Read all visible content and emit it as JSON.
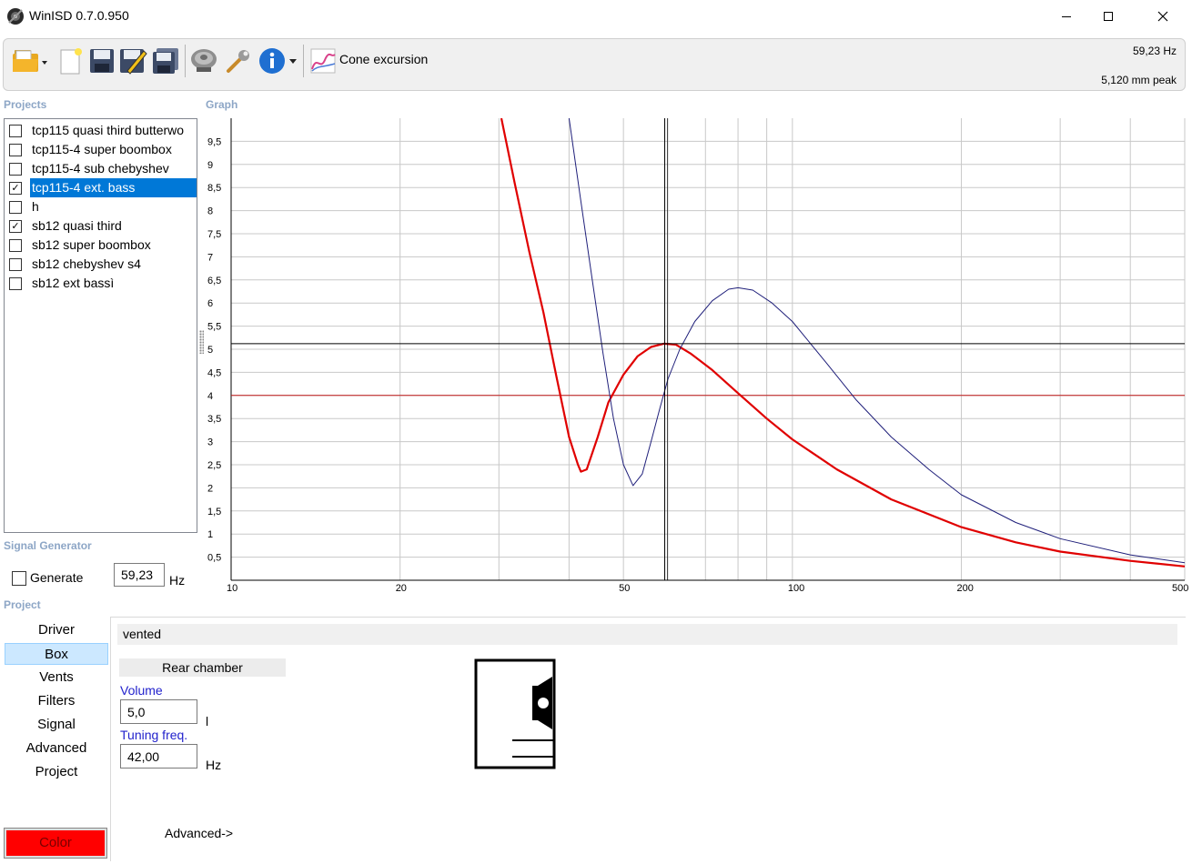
{
  "window": {
    "title": "WinISD 0.7.0.950",
    "controls": {
      "minimize": "—",
      "maximize": "☐",
      "close": "✕"
    }
  },
  "toolbar": {
    "buttons": [
      "open-folder-icon",
      "new-project-icon",
      "save-icon",
      "save-as-icon",
      "save-all-icon",
      "driver-icon",
      "tools-icon",
      "info-icon",
      "graph-icon"
    ],
    "graph_label": "Cone excursion",
    "frequency_readout": "59,23 Hz",
    "peak_readout": "5,120 mm peak"
  },
  "projects": {
    "label": "Projects",
    "items": [
      {
        "name": "tcp115 quasi third butterwo",
        "checked": false,
        "selected": false
      },
      {
        "name": "tcp115-4 super boombox",
        "checked": false,
        "selected": false
      },
      {
        "name": "tcp115-4 sub chebyshev",
        "checked": false,
        "selected": false
      },
      {
        "name": "tcp115-4 ext. bass",
        "checked": true,
        "selected": true
      },
      {
        "name": "h",
        "checked": false,
        "selected": false
      },
      {
        "name": "sb12 quasi third",
        "checked": true,
        "selected": false
      },
      {
        "name": "sb12 super boombox",
        "checked": false,
        "selected": false
      },
      {
        "name": "sb12 chebyshev s4",
        "checked": false,
        "selected": false
      },
      {
        "name": "sb12 ext bassì",
        "checked": false,
        "selected": false
      }
    ]
  },
  "signal_generator": {
    "label": "Signal Generator",
    "generate_label": "Generate",
    "generate_checked": false,
    "frequency": "59,23",
    "unit": "Hz"
  },
  "graph": {
    "label": "Graph"
  },
  "chart_data": {
    "type": "line",
    "x_scale": "log",
    "xlim": [
      10,
      500
    ],
    "ylim": [
      0,
      10
    ],
    "x_ticks": [
      "10",
      "20",
      "50",
      "100",
      "200",
      "500"
    ],
    "y_ticks": [
      "0,5",
      "1",
      "1,5",
      "2",
      "2,5",
      "3",
      "3,5",
      "4",
      "4,5",
      "5",
      "5,5",
      "6",
      "6,5",
      "7",
      "7,5",
      "8",
      "8,5",
      "9",
      "9,5"
    ],
    "grid": true,
    "cursor": {
      "x": 59.23,
      "y": 5.12,
      "y_limit": 4.0
    },
    "series": [
      {
        "color": "#e00000",
        "points": [
          [
            30.3,
            10.0
          ],
          [
            32,
            8.6
          ],
          [
            34,
            7.1
          ],
          [
            36,
            5.8
          ],
          [
            38,
            4.4
          ],
          [
            40,
            3.1
          ],
          [
            41.5,
            2.5
          ],
          [
            42,
            2.35
          ],
          [
            43,
            2.4
          ],
          [
            45,
            3.1
          ],
          [
            47,
            3.85
          ],
          [
            50,
            4.45
          ],
          [
            53,
            4.85
          ],
          [
            56,
            5.05
          ],
          [
            59,
            5.12
          ],
          [
            62,
            5.1
          ],
          [
            66,
            4.9
          ],
          [
            72,
            4.55
          ],
          [
            80,
            4.05
          ],
          [
            90,
            3.5
          ],
          [
            100,
            3.05
          ],
          [
            120,
            2.4
          ],
          [
            150,
            1.75
          ],
          [
            200,
            1.15
          ],
          [
            250,
            0.82
          ],
          [
            300,
            0.62
          ],
          [
            400,
            0.42
          ],
          [
            500,
            0.3
          ]
        ]
      },
      {
        "color": "#1f1f7a",
        "points": [
          [
            40.0,
            10.0
          ],
          [
            42,
            8.2
          ],
          [
            44,
            6.5
          ],
          [
            46,
            4.9
          ],
          [
            48,
            3.5
          ],
          [
            50,
            2.5
          ],
          [
            52,
            2.05
          ],
          [
            54,
            2.3
          ],
          [
            56,
            3.0
          ],
          [
            58,
            3.7
          ],
          [
            60,
            4.35
          ],
          [
            63,
            5.0
          ],
          [
            67,
            5.6
          ],
          [
            72,
            6.05
          ],
          [
            77,
            6.3
          ],
          [
            80,
            6.33
          ],
          [
            85,
            6.28
          ],
          [
            92,
            6.0
          ],
          [
            100,
            5.6
          ],
          [
            115,
            4.7
          ],
          [
            130,
            3.9
          ],
          [
            150,
            3.1
          ],
          [
            175,
            2.4
          ],
          [
            200,
            1.85
          ],
          [
            250,
            1.25
          ],
          [
            300,
            0.9
          ],
          [
            400,
            0.55
          ],
          [
            500,
            0.38
          ]
        ]
      }
    ]
  },
  "project_panel": {
    "label": "Project",
    "nav": [
      {
        "label": "Driver",
        "selected": false
      },
      {
        "label": "Box",
        "selected": true
      },
      {
        "label": "Vents",
        "selected": false
      },
      {
        "label": "Filters",
        "selected": false
      },
      {
        "label": "Signal",
        "selected": false
      },
      {
        "label": "Advanced",
        "selected": false
      },
      {
        "label": "Project",
        "selected": false
      }
    ],
    "color_button": "Color",
    "color_value": "#ff0000"
  },
  "box": {
    "type": "vented",
    "rear_chamber_label": "Rear chamber",
    "volume_label": "Volume",
    "volume_value": "5,0",
    "volume_unit": "l",
    "tuning_label": "Tuning freq.",
    "tuning_value": "42,00",
    "tuning_unit": "Hz",
    "advanced_link": "Advanced->"
  }
}
